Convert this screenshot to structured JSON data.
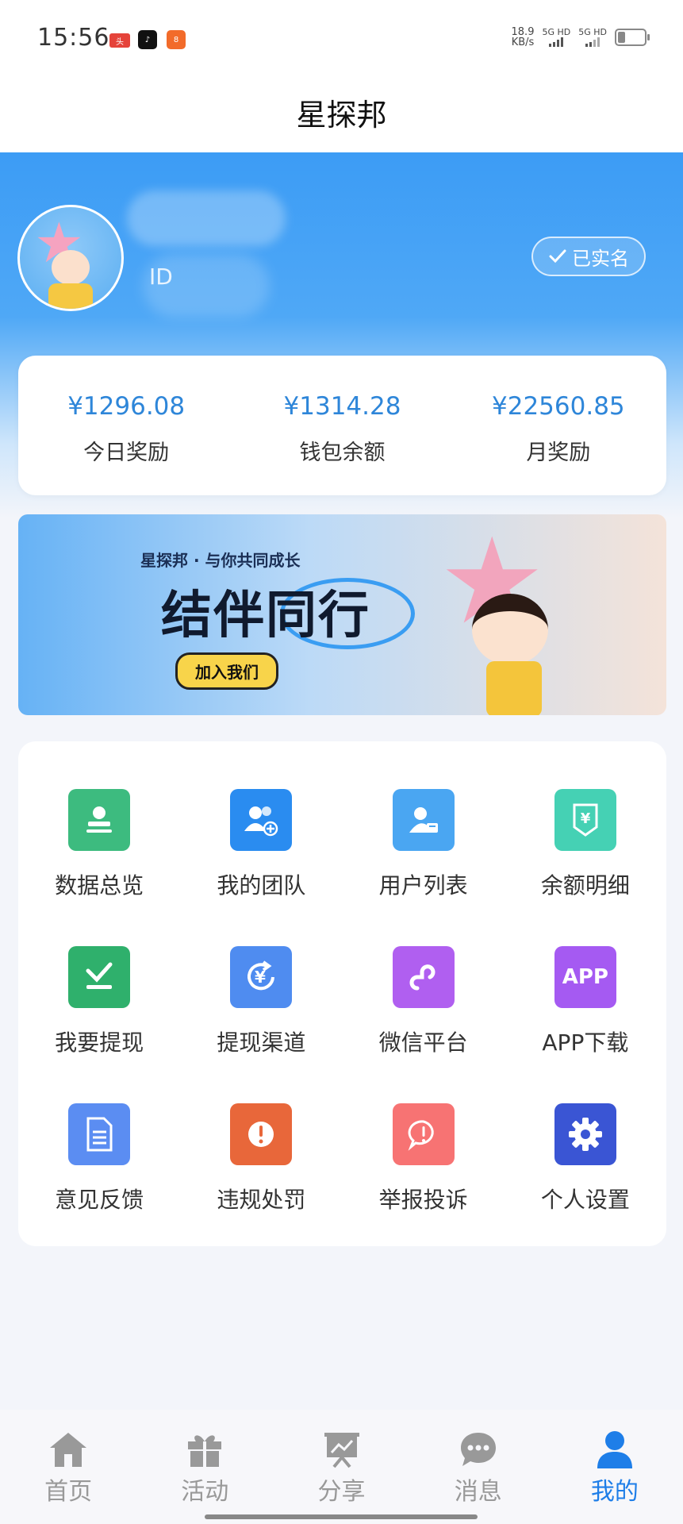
{
  "status": {
    "time": "15:56",
    "net_speed": "18.9",
    "net_unit": "KB/s",
    "sim1": "5G HD",
    "sim2": "5G HD"
  },
  "header": {
    "title": "星探邦"
  },
  "profile": {
    "id_text": "ID",
    "verified_label": "已实名"
  },
  "stats": [
    {
      "value": "¥1296.08",
      "label": "今日奖励"
    },
    {
      "value": "¥1314.28",
      "label": "钱包余额"
    },
    {
      "value": "¥22560.85",
      "label": "月奖励"
    }
  ],
  "banner": {
    "slogan": "星探邦 · 与你共同成长",
    "headline": "结伴同行",
    "button": "加入我们"
  },
  "menu": [
    {
      "label": "数据总览",
      "icon": "stamp-icon",
      "color": "#3dbb7f"
    },
    {
      "label": "我的团队",
      "icon": "team-icon",
      "color": "#2a8cf0"
    },
    {
      "label": "用户列表",
      "icon": "user-card-icon",
      "color": "#4aa6f2"
    },
    {
      "label": "余额明细",
      "icon": "yuan-badge-icon",
      "color": "#45d1b4"
    },
    {
      "label": "我要提现",
      "icon": "withdraw-check-icon",
      "color": "#2fb06c"
    },
    {
      "label": "提现渠道",
      "icon": "yuan-refresh-icon",
      "color": "#4f8cf0"
    },
    {
      "label": "微信平台",
      "icon": "link-icon",
      "color": "#b05ff0"
    },
    {
      "label": "APP下载",
      "icon": "app-icon",
      "icon_text": "APP",
      "color": "#a55af2"
    },
    {
      "label": "意见反馈",
      "icon": "document-icon",
      "color": "#5b8df2"
    },
    {
      "label": "违规处罚",
      "icon": "warning-icon",
      "color": "#e8673a"
    },
    {
      "label": "举报投诉",
      "icon": "report-icon",
      "color": "#f77373"
    },
    {
      "label": "个人设置",
      "icon": "gear-icon",
      "color": "#3a55d4"
    }
  ],
  "tabs": [
    {
      "label": "首页",
      "icon": "home-icon",
      "active": false
    },
    {
      "label": "活动",
      "icon": "gift-icon",
      "active": false
    },
    {
      "label": "分享",
      "icon": "share-chart-icon",
      "active": false
    },
    {
      "label": "消息",
      "icon": "chat-icon",
      "active": false
    },
    {
      "label": "我的",
      "icon": "person-icon",
      "active": true
    }
  ]
}
